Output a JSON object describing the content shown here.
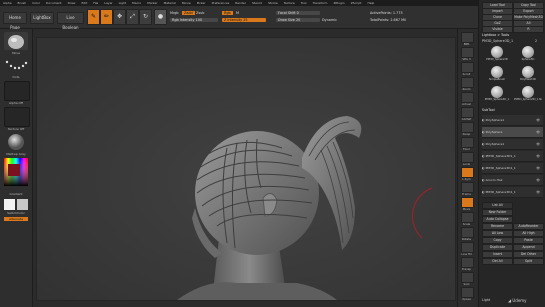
{
  "menu": [
    "Alpha",
    "Brush",
    "Color",
    "Document",
    "Draw",
    "Edit",
    "File",
    "Layer",
    "Light",
    "Macro",
    "Marker",
    "Material",
    "Movie",
    "Picker",
    "Preferences",
    "Render",
    "Stencil",
    "Stroke",
    "Texture",
    "Tool",
    "Transform",
    "ZPlugin",
    "ZScript",
    "Help"
  ],
  "topbar": {
    "home_page": "Home Page",
    "lightbox": "LightBox",
    "live_boolean": "Live Boolean",
    "edit": "Edit",
    "draw": "Draw",
    "move": "Move",
    "scale": "Scale",
    "rotate": "Rotate",
    "mrgb": "Mrgb",
    "rgb": "Rgb",
    "m": "M",
    "zadd": "Zadd",
    "zsub": "Zsub",
    "zcut": "Zcut",
    "rgb_intensity": "Rgb Intensity 100",
    "z_intensity": "Z Intensity 25",
    "focal_shift": "Focal Shift 0",
    "draw_size": "Draw Size 20",
    "dynamic": "Dynamic",
    "active_points": "ActivePoints: 1.775",
    "total_points": "TotalPoints: 2.667 Mil"
  },
  "leftshelf": {
    "brush_label": "Move",
    "stroke_label": "Dots",
    "alpha_label": "Alpha Off",
    "texture_label": "Texture Off",
    "material_label": "MatCap Gray",
    "gradient_label": "Gradient",
    "switch_label": "SwitchColor",
    "alternate_label": "Alternate"
  },
  "rightshelf": [
    "BPR",
    "SPix 3",
    "Scroll",
    "Zoom",
    "Actual",
    "AAHalf",
    "Persp",
    "Floor",
    "Local",
    "L.Sym",
    "Frame",
    "Move",
    "Scale",
    "Rotate",
    "Line Fill",
    "Transp",
    "Solo",
    "Xpose"
  ],
  "tray": {
    "top_rows": [
      "Load Tool",
      "Copy Tool",
      "Import",
      "Export",
      "Clone",
      "Make PolyMesh3D",
      "GoZ",
      "All",
      "Visible",
      "R"
    ],
    "lightbox_tools": "Lightbox > Tools",
    "tool_name": "PM3D_Sphere3D_1",
    "tool_count": "2",
    "tool_thumbs": [
      "PM3D_Sphere3D",
      "Sphere3D",
      "SimpleBrush",
      "PolyMesh3D",
      "PM3D_Sphere3D_1",
      "PM3D_Sphere3D_1 No"
    ],
    "subtool_header": "SubTool",
    "subtools": [
      "PolySphere1",
      "PolySphere",
      "PolySphere1",
      "PM3D_Sphere3D1_1",
      "PM3D_Sphere3D1_1",
      "Groom Hair",
      "PM3D_Sphere3D1_1"
    ],
    "bottom": [
      "List All",
      "New Folder",
      "Auto Collapse",
      "Rename",
      "AutoReorder",
      "All Low",
      "All High",
      "Copy",
      "Paste",
      "Duplicate",
      "Append",
      "Insert",
      "Del Other",
      "Del All",
      "Split"
    ],
    "lightbox_hint": "Light"
  },
  "watermark": "Udemy"
}
